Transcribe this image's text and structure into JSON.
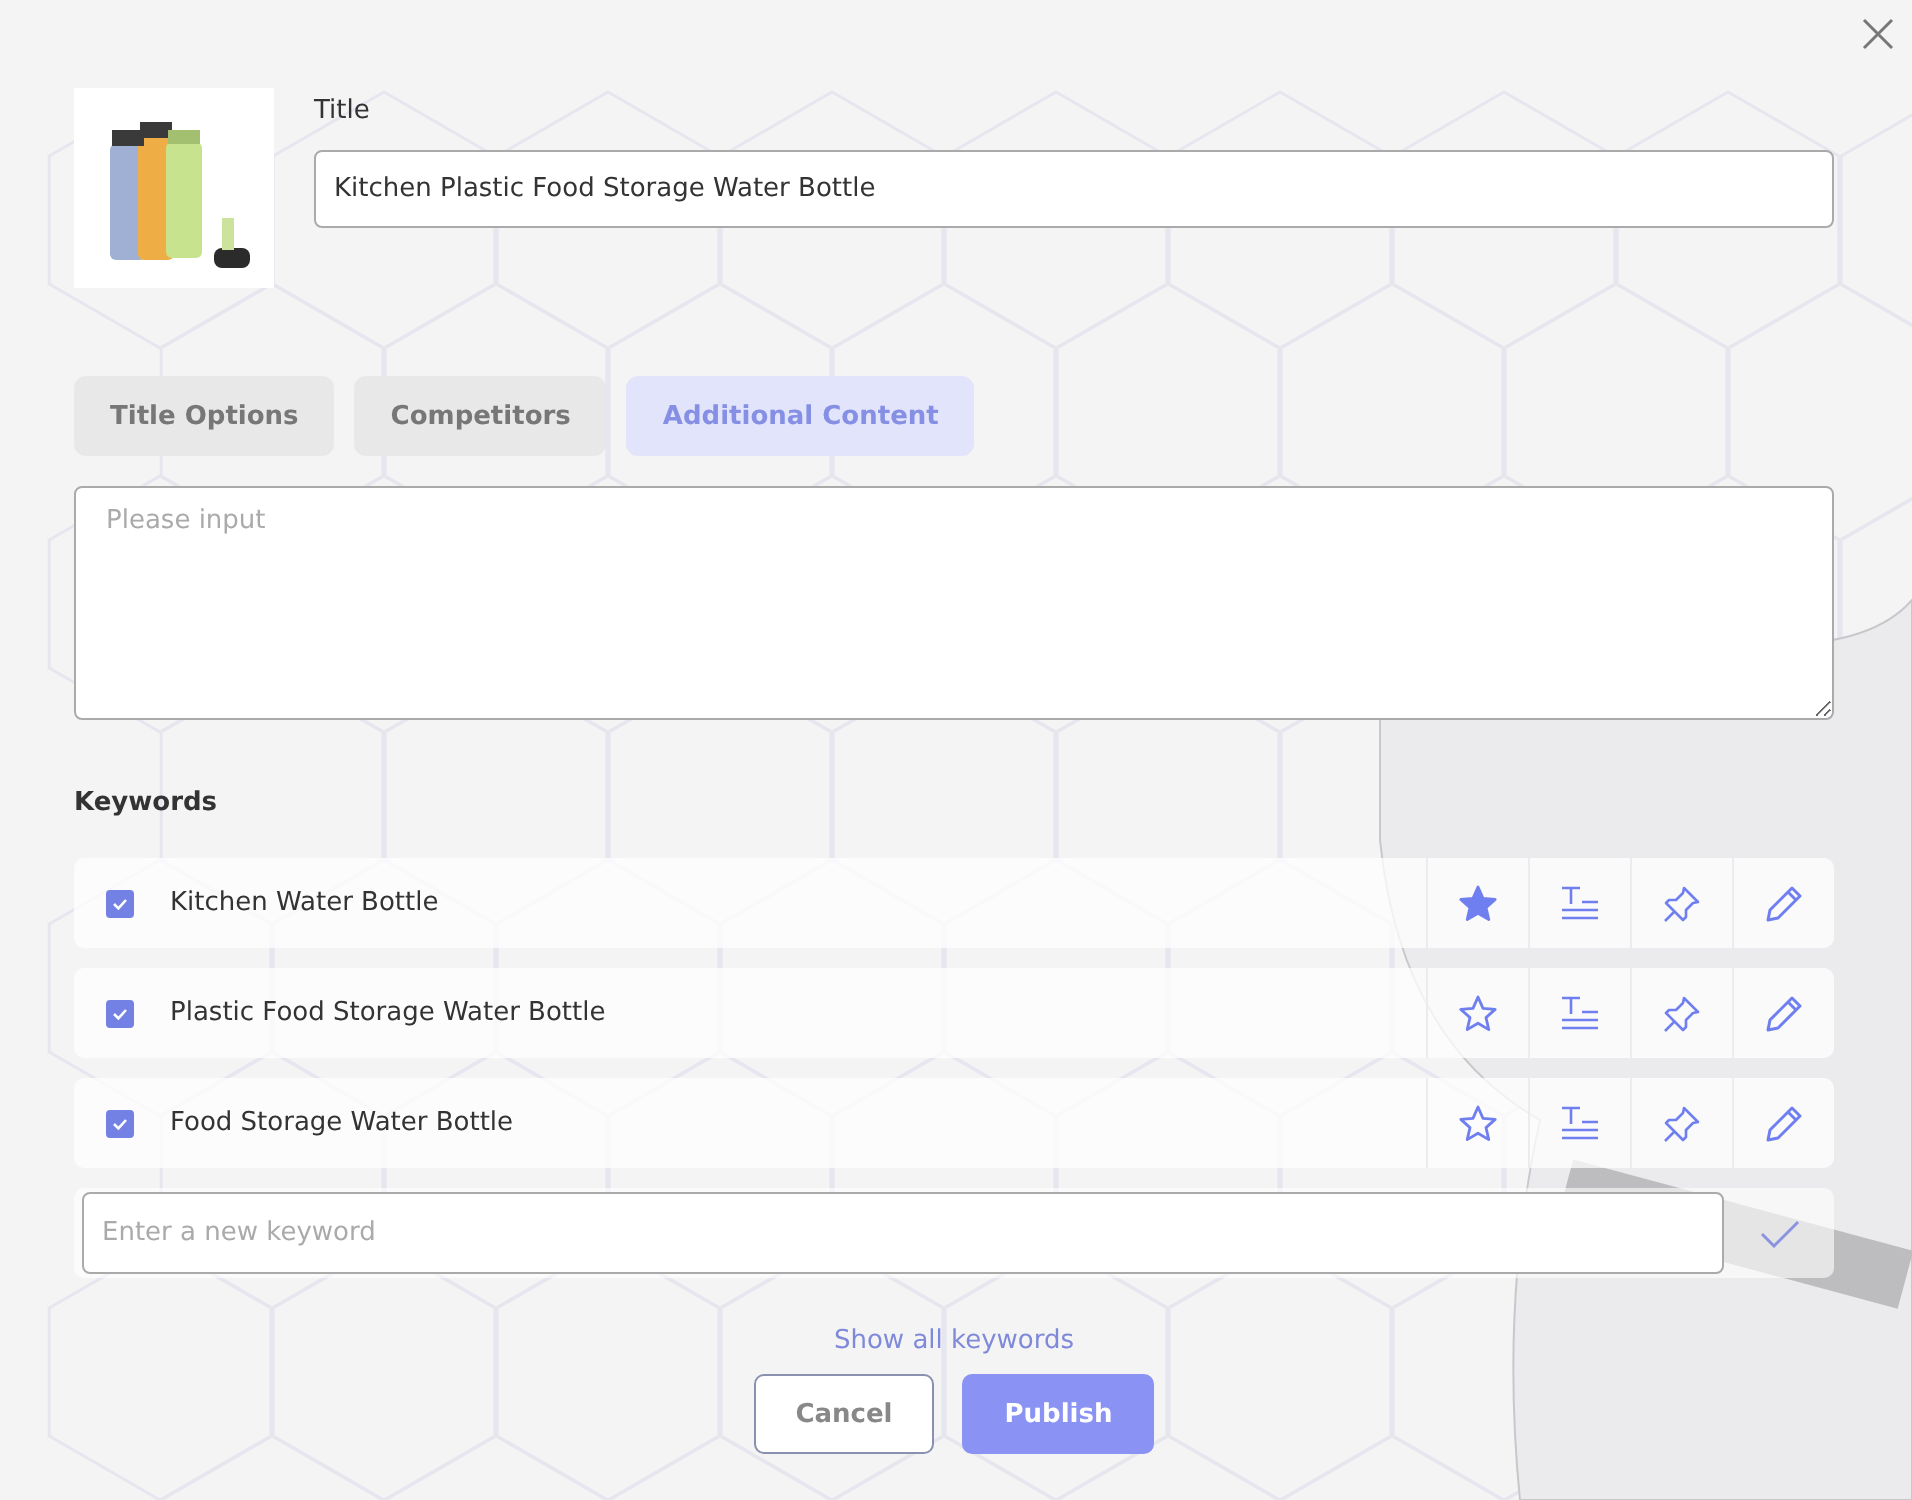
{
  "title_field": {
    "label": "Title",
    "value": "Kitchen Plastic Food Storage Water Bottle"
  },
  "tabs": [
    {
      "label": "Title Options",
      "selected": false
    },
    {
      "label": "Competitors",
      "selected": false
    },
    {
      "label": "Additional Content",
      "selected": true
    }
  ],
  "content_field": {
    "placeholder": "Please input"
  },
  "keywords": {
    "heading": "Keywords",
    "items": [
      {
        "text": "Kitchen Water Bottle",
        "checked": true,
        "starred": true
      },
      {
        "text": "Plastic Food Storage Water Bottle",
        "checked": true,
        "starred": false
      },
      {
        "text": "Food Storage Water Bottle",
        "checked": true,
        "starred": false
      }
    ],
    "new_keyword": {
      "placeholder": "Enter a new keyword"
    },
    "show_all": "Show all keywords"
  },
  "buttons": {
    "cancel": "Cancel",
    "publish": "Publish"
  }
}
